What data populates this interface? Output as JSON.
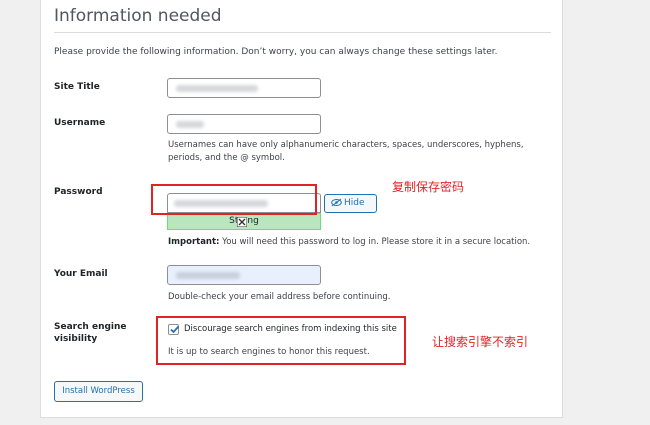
{
  "heading": "Information needed",
  "intro": "Please provide the following information. Don’t worry, you can always change these settings later.",
  "fields": {
    "site_title": {
      "label": "Site Title"
    },
    "username": {
      "label": "Username",
      "desc_line1": "Usernames can have only alphanumeric characters, spaces, underscores, hyphens,",
      "desc_line2": "periods, and the @ symbol."
    },
    "password": {
      "label": "Password",
      "strength": "Strong",
      "hide_label": "Hide",
      "important_label": "Important:",
      "important_text": " You will need this password to log in. Please store it in a secure location."
    },
    "email": {
      "label": "Your Email",
      "desc": "Double-check your email address before continuing."
    },
    "search": {
      "label_line1": "Search engine",
      "label_line2": "visibility",
      "checkbox_label": "Discourage search engines from indexing this site",
      "checked": true,
      "note": "It is up to search engines to honor this request."
    }
  },
  "submit_label": "Install WordPress",
  "annotations": {
    "password_note": "复制保存密码",
    "search_note": "让搜索引擎不索引"
  },
  "colors": {
    "accent": "#2271b1",
    "annotation": "#e02424",
    "strength_bg": "#b8e6bf"
  }
}
